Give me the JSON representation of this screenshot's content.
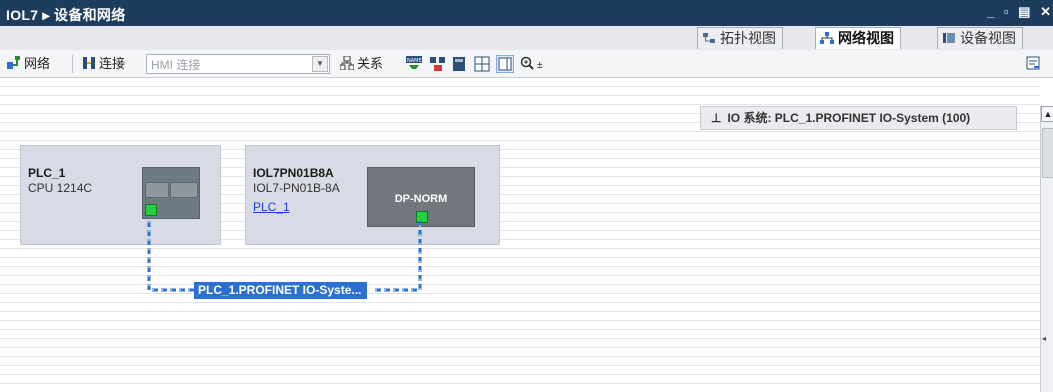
{
  "window": {
    "title": "IOL7 ▸ 设备和网络",
    "controls": [
      "_",
      "▫",
      "▤",
      "✕"
    ]
  },
  "view_tabs": [
    {
      "label": "拓扑视图",
      "icon": "topology-icon",
      "active": false
    },
    {
      "label": "网络视图",
      "icon": "network-view-icon",
      "active": true
    },
    {
      "label": "设备视图",
      "icon": "device-view-icon",
      "active": false
    }
  ],
  "toolbar": {
    "network_label": "网络",
    "connect_label": "连接",
    "connection_type": "HMI 连接",
    "relation_label": "关系"
  },
  "io_system_bar": {
    "text": "IO 系统: PLC_1.PROFINET IO-System (100)"
  },
  "devices": [
    {
      "name": "PLC_1",
      "type": "CPU 1214C",
      "link": ""
    },
    {
      "name": "IOL7PN01B8A",
      "type": "IOL7-PN01B-8A",
      "link": "PLC_1",
      "module_label": "DP-NORM"
    }
  ],
  "network": {
    "label": "PLC_1.PROFINET IO-Syste..."
  },
  "colors": {
    "title_bg": "#1d3d5e",
    "device_bg": "#d8dbe5",
    "network_line": "#2b6fd3",
    "port_led": "#21d13e"
  }
}
